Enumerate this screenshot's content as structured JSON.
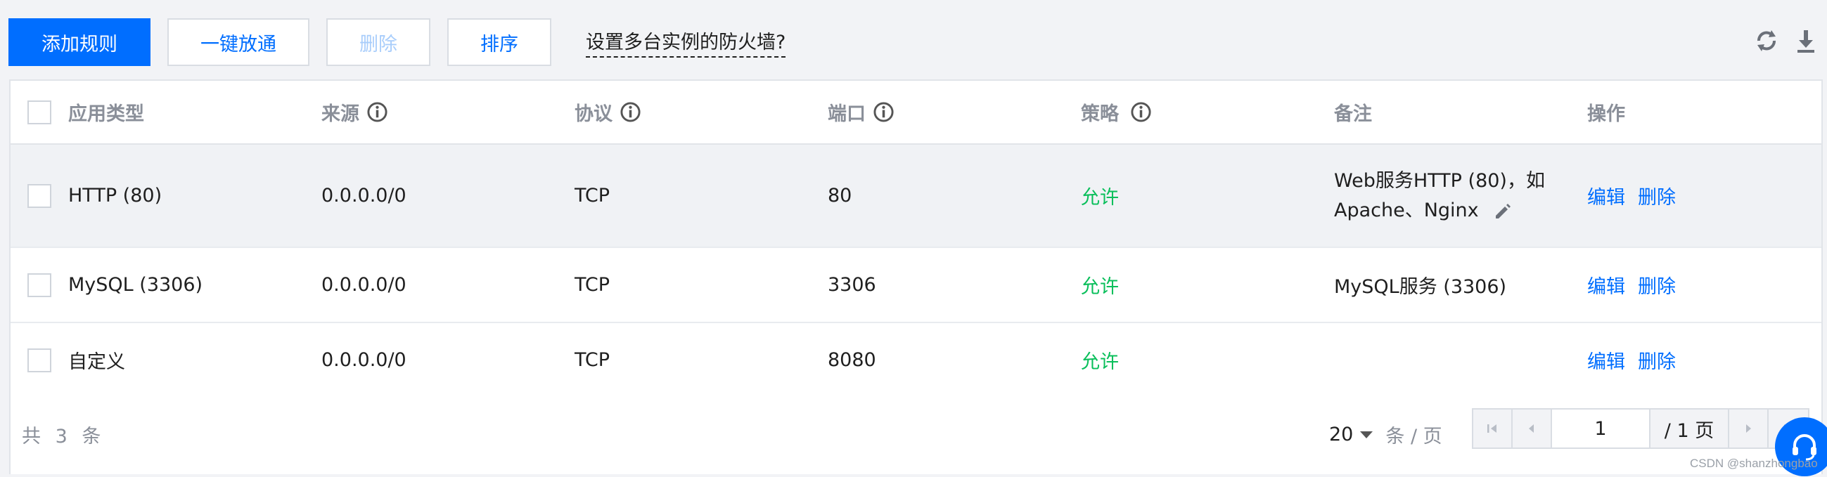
{
  "toolbar": {
    "add_rule_label": "添加规则",
    "batch_open_label": "一键放通",
    "delete_label": "删除",
    "sort_label": "排序",
    "multi_instance_link": "设置多台实例的防火墙?",
    "icons": [
      "refresh-icon",
      "download-icon"
    ]
  },
  "table": {
    "headers": {
      "app_type": "应用类型",
      "source": "来源",
      "protocol": "协议",
      "port": "端口",
      "policy": "策略",
      "note": "备注",
      "actions": "操作"
    },
    "rows": [
      {
        "app_type": "HTTP (80)",
        "source": "0.0.0.0/0",
        "protocol": "TCP",
        "port": "80",
        "policy": "允许",
        "note": "Web服务HTTP (80)，如Apache、Nginx",
        "edit": "编辑",
        "delete": "删除"
      },
      {
        "app_type": "MySQL (3306)",
        "source": "0.0.0.0/0",
        "protocol": "TCP",
        "port": "3306",
        "policy": "允许",
        "note": "MySQL服务 (3306)",
        "edit": "编辑",
        "delete": "删除"
      },
      {
        "app_type": "自定义",
        "source": "0.0.0.0/0",
        "protocol": "TCP",
        "port": "8080",
        "policy": "允许",
        "note": "",
        "edit": "编辑",
        "delete": "删除"
      }
    ]
  },
  "footer": {
    "total_text": "共 3 条",
    "page_size": "20",
    "page_size_unit": "条 / 页",
    "current_page": "1",
    "total_pages": "/ 1 页"
  },
  "watermark": "CSDN @shanzhongbao",
  "colors": {
    "primary": "#006eff",
    "allow": "#0abf5b",
    "header_text": "#8a8f99"
  }
}
